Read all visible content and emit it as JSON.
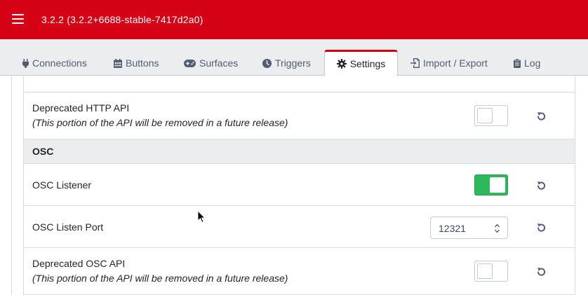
{
  "header": {
    "title": "3.2.2 (3.2.2+6688-stable-7417d2a0)"
  },
  "tabs": [
    {
      "label": "Connections",
      "icon": "plug-icon"
    },
    {
      "label": "Buttons",
      "icon": "calendar-grid-icon"
    },
    {
      "label": "Surfaces",
      "icon": "gamepad-icon"
    },
    {
      "label": "Triggers",
      "icon": "clock-icon"
    },
    {
      "label": "Settings",
      "icon": "gear-icon",
      "active": true
    },
    {
      "label": "Import / Export",
      "icon": "file-import-icon"
    },
    {
      "label": "Log",
      "icon": "clipboard-icon"
    }
  ],
  "settings": {
    "deprecated_http": {
      "label": "Deprecated HTTP API",
      "sublabel": "(This portion of the API will be removed in a future release)",
      "enabled": false
    },
    "osc_section": {
      "title": "OSC"
    },
    "osc_listener": {
      "label": "OSC Listener",
      "enabled": true
    },
    "osc_port": {
      "label": "OSC Listen Port",
      "value": "12321"
    },
    "deprecated_osc": {
      "label": "Deprecated OSC API",
      "sublabel": "(This portion of the API will be removed in a future release)",
      "enabled": false
    }
  },
  "colors": {
    "brand": "#d50215",
    "toggle_on": "#2eb85c"
  }
}
